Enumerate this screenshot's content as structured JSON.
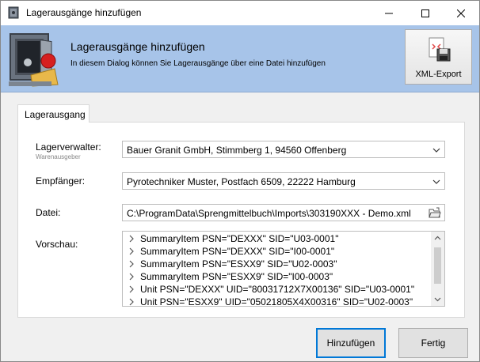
{
  "window": {
    "title": "Lagerausgänge hinzufügen"
  },
  "header": {
    "title": "Lagerausgänge hinzufügen",
    "subtitle": "In diesem Dialog können Sie Lagerausgänge über eine Datei hinzufügen",
    "xml_export_label": "XML-Export"
  },
  "tab": {
    "label": "Lagerausgang"
  },
  "form": {
    "lagerverwalter_label": "Lagerverwalter:",
    "lagerverwalter_sublabel": "Warenausgeber",
    "lagerverwalter_value": "Bauer Granit GmbH, Stimmberg 1, 94560 Offenberg",
    "empfaenger_label": "Empfänger:",
    "empfaenger_value": "Pyrotechniker Muster, Postfach 6509, 22222 Hamburg",
    "datei_label": "Datei:",
    "datei_value": "C:\\ProgramData\\Sprengmittelbuch\\Imports\\303190XXX - Demo.xml",
    "vorschau_label": "Vorschau:"
  },
  "preview_rows": [
    "SummaryItem PSN=\"DEXXX\" SID=\"U03-0001\"",
    "SummaryItem PSN=\"DEXXX\" SID=\"I00-0001\"",
    "SummaryItem PSN=\"ESXX9\" SID=\"U02-0003\"",
    "SummaryItem PSN=\"ESXX9\" SID=\"I00-0003\"",
    "Unit PSN=\"DEXXX\" UID=\"80031712X7X00136\" SID=\"U03-0001\"",
    "Unit PSN=\"ESXX9\" UID=\"05021805X4X00316\" SID=\"U02-0003\""
  ],
  "buttons": {
    "add": "Hinzufügen",
    "done": "Fertig"
  },
  "colors": {
    "banner": "#a7c4e9",
    "accent": "#0078d7"
  }
}
